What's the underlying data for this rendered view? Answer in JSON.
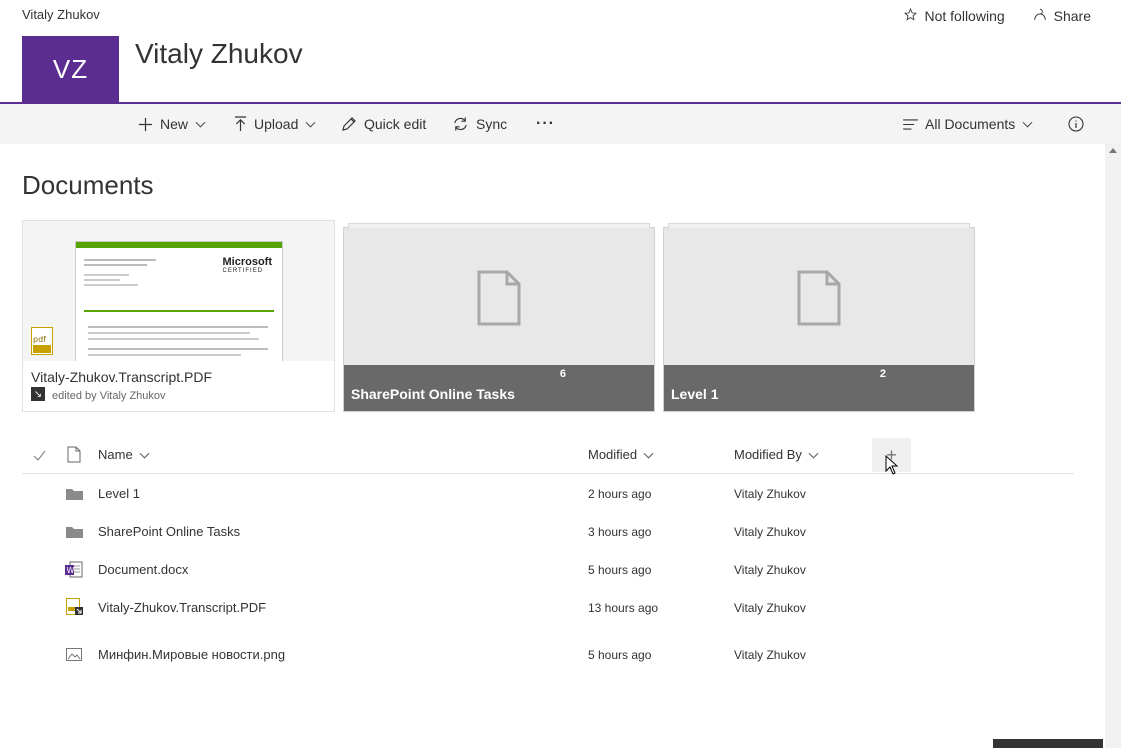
{
  "header": {
    "breadcrumb": "Vitaly Zhukov",
    "logo_initials": "VZ",
    "site_title": "Vitaly Zhukov",
    "follow_label": "Not following",
    "share_label": "Share",
    "accent_color": "#5c2d91"
  },
  "commandbar": {
    "new_label": "New",
    "upload_label": "Upload",
    "quick_edit_label": "Quick edit",
    "sync_label": "Sync",
    "more_label": "···",
    "view_label": "All Documents"
  },
  "library": {
    "title": "Documents",
    "tiles": [
      {
        "name": "Vitaly-Zhukov.Transcript.PDF",
        "subtitle": "edited by Vitaly Zhukov",
        "type": "pdf",
        "preview_brand": "Microsoft",
        "preview_sub": "CERTIFIED"
      },
      {
        "name": "SharePoint Online Tasks",
        "count": "6",
        "type": "folder"
      },
      {
        "name": "Level 1",
        "count": "2",
        "type": "folder"
      }
    ],
    "columns": {
      "name": "Name",
      "modified": "Modified",
      "modified_by": "Modified By",
      "add_column": "+"
    },
    "rows": [
      {
        "name": "Level 1",
        "modified": "2 hours ago",
        "modified_by": "Vitaly Zhukov",
        "icon": "folder-icon"
      },
      {
        "name": "SharePoint Online Tasks",
        "modified": "3 hours ago",
        "modified_by": "Vitaly Zhukov",
        "icon": "folder-icon"
      },
      {
        "name": "Document.docx",
        "modified": "5 hours ago",
        "modified_by": "Vitaly Zhukov",
        "icon": "word-doc-icon"
      },
      {
        "name": "Vitaly-Zhukov.Transcript.PDF",
        "modified": "13 hours ago",
        "modified_by": "Vitaly Zhukov",
        "icon": "pdf-file-icon"
      },
      {
        "name": "Минфин.Мировые новости.png",
        "modified": "5 hours ago",
        "modified_by": "Vitaly Zhukov",
        "icon": "image-file-icon"
      }
    ]
  }
}
